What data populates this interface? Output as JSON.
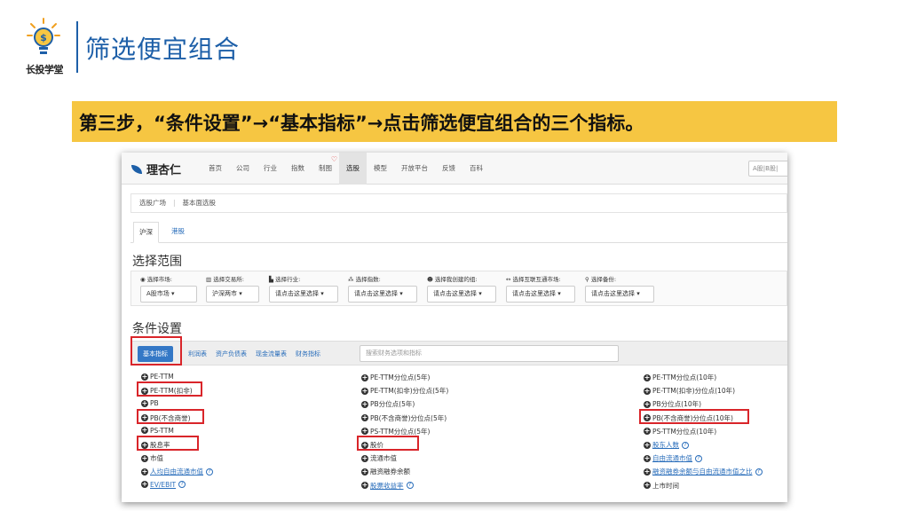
{
  "slide": {
    "title": "筛选便宜组合",
    "logo_caption": "长投学堂",
    "instruction": "第三步，“条件设置”→“基本指标”→点击筛选便宜组合的三个指标。"
  },
  "app": {
    "brand": "理杏仁",
    "nav": [
      "首页",
      "公司",
      "行业",
      "指数",
      "制图",
      "选股",
      "模型",
      "开放平台",
      "反馈",
      "百科"
    ],
    "active_nav": "选股",
    "search_placeholder": "A股|B股|",
    "breadcrumb": [
      "选股广场",
      "基本面选股"
    ],
    "tabs": [
      "沪深",
      "港股"
    ],
    "range_title": "选择范围",
    "filters": [
      {
        "label": "选择市场:",
        "value": "A股市场 ▾"
      },
      {
        "label": "选择交易所:",
        "value": "沪深两市 ▾"
      },
      {
        "label": "选择行业:",
        "value": "请点击这里选择 ▾"
      },
      {
        "label": "选择指数:",
        "value": "请点击这里选择 ▾"
      },
      {
        "label": "选择我创建的组:",
        "value": "请点击这里选择 ▾"
      },
      {
        "label": "选择互联互通市场:",
        "value": "请点击这里选择 ▾"
      },
      {
        "label": "选择备份:",
        "value": "请点击这里选择 ▾"
      }
    ],
    "condition_title": "条件设置",
    "condition_button": "基本指标",
    "condition_tabs": [
      "利润表",
      "资产负债表",
      "现金流量表",
      "财务指标"
    ],
    "condition_search_placeholder": "搜索财务选项和指标",
    "metrics": {
      "col1": [
        "PE-TTM",
        "PE-TTM(扣非)",
        "PB",
        "PB(不含商誉)",
        "PS-TTM",
        "股息率",
        "市值",
        "人均自由流通市值",
        "EV/EBIT"
      ],
      "col2": [
        "PE-TTM分位点(5年)",
        "PE-TTM(扣非)分位点(5年)",
        "PB分位点(5年)",
        "PB(不含商誉)分位点(5年)",
        "PS-TTM分位点(5年)",
        "股价",
        "流通市值",
        "融资融券余额",
        "股票收益率"
      ],
      "col3": [
        "PE-TTM分位点(10年)",
        "PE-TTM(扣非)分位点(10年)",
        "PB分位点(10年)",
        "PB(不含商誉)分位点(10年)",
        "PS-TTM分位点(10年)",
        "股东人数",
        "自由流通市值",
        "融资融券余额与自由流通市值之比",
        "上市时间"
      ]
    },
    "help_mark": "?"
  },
  "colors": {
    "accent_blue": "#1d5fa8",
    "banner_yellow": "#f6c642",
    "highlight_red": "#d9252a",
    "link_blue": "#2a6ebb"
  }
}
